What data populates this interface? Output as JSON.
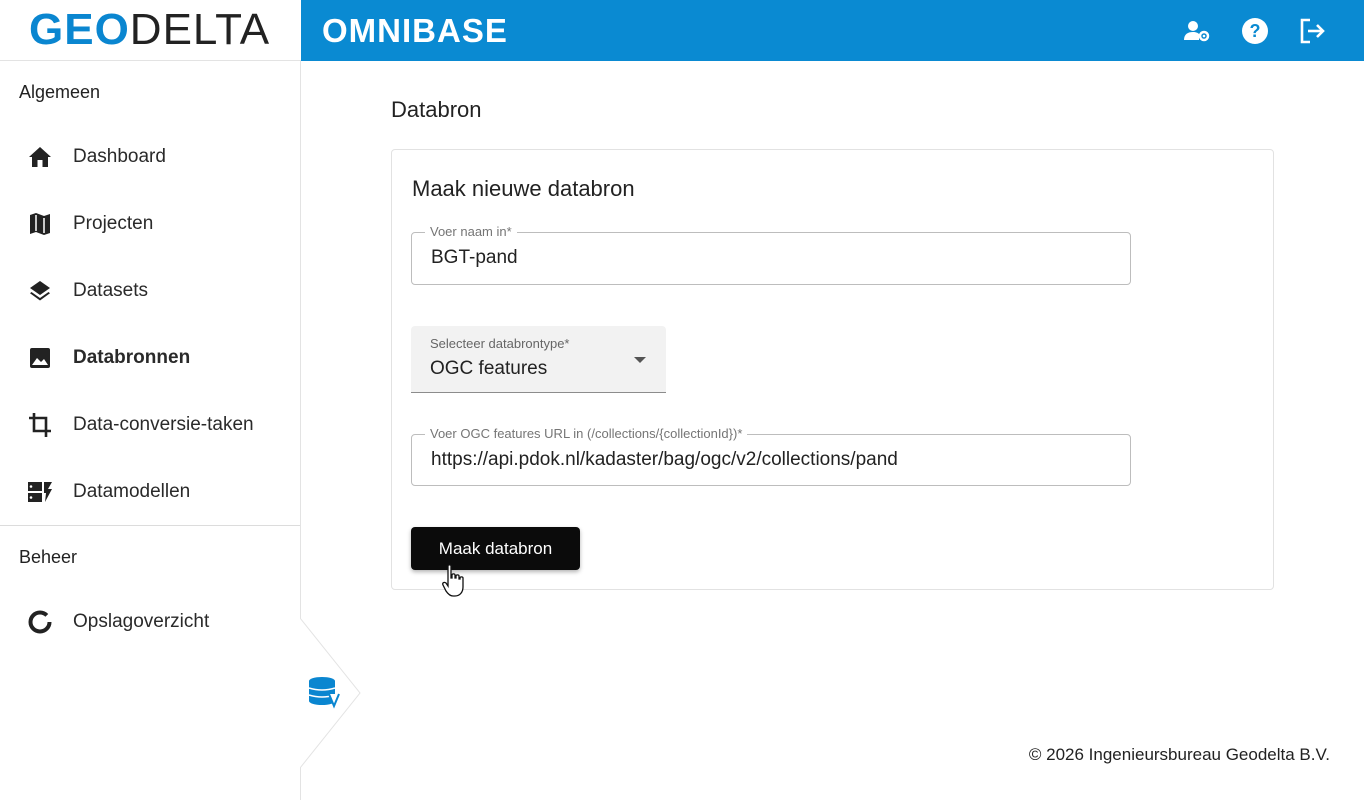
{
  "brand": {
    "logo_part1": "GEO",
    "logo_part2": "DELTA",
    "app_title": "OMNIBASE"
  },
  "topbar": {
    "icons": [
      "user-settings-icon",
      "help-icon",
      "logout-icon"
    ]
  },
  "sidebar": {
    "section_general": "Algemeen",
    "items": [
      {
        "label": "Dashboard",
        "icon": "home-icon"
      },
      {
        "label": "Projecten",
        "icon": "map-icon"
      },
      {
        "label": "Datasets",
        "icon": "layers-icon"
      },
      {
        "label": "Databronnen",
        "icon": "image-icon",
        "active": true
      },
      {
        "label": "Data-conversie-taken",
        "icon": "crop-icon"
      },
      {
        "label": "Datamodellen",
        "icon": "model-icon"
      }
    ],
    "section_admin": "Beheer",
    "admin_items": [
      {
        "label": "Opslagoverzicht",
        "icon": "donut-chart-icon"
      }
    ]
  },
  "main": {
    "page_title": "Databron",
    "card_title": "Maak nieuwe databron",
    "name_field": {
      "label": "Voer naam in*",
      "value": "BGT-pand"
    },
    "type_field": {
      "label": "Selecteer databrontype*",
      "value": "OGC features"
    },
    "url_field": {
      "label": "Voer OGC features URL in (/collections/{collectionId})*",
      "value": "https://api.pdok.nl/kadaster/bag/ogc/v2/collections/pand"
    },
    "submit_label": "Maak databron"
  },
  "footer": {
    "copyright": "© 2026 Ingenieursbureau Geodelta B.V."
  },
  "colors": {
    "brand_blue": "#0a8ad2",
    "button_black": "#0b0b0b"
  }
}
